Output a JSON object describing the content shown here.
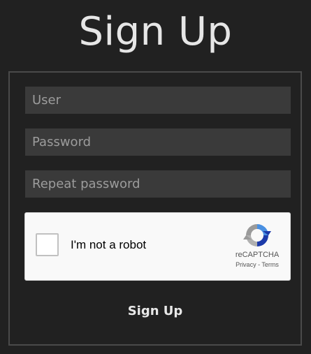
{
  "page": {
    "title": "Sign Up"
  },
  "form": {
    "user_placeholder": "User",
    "password_placeholder": "Password",
    "repeat_placeholder": "Repeat password",
    "submit_label": "Sign Up"
  },
  "captcha": {
    "label": "I'm not a robot",
    "brand": "reCAPTCHA",
    "privacy": "Privacy",
    "separator": " - ",
    "terms": "Terms",
    "checked": false
  },
  "colors": {
    "background": "#212121",
    "field_background": "#3a3a3a",
    "border": "#4a4a4a",
    "text": "#e6e6e6"
  }
}
